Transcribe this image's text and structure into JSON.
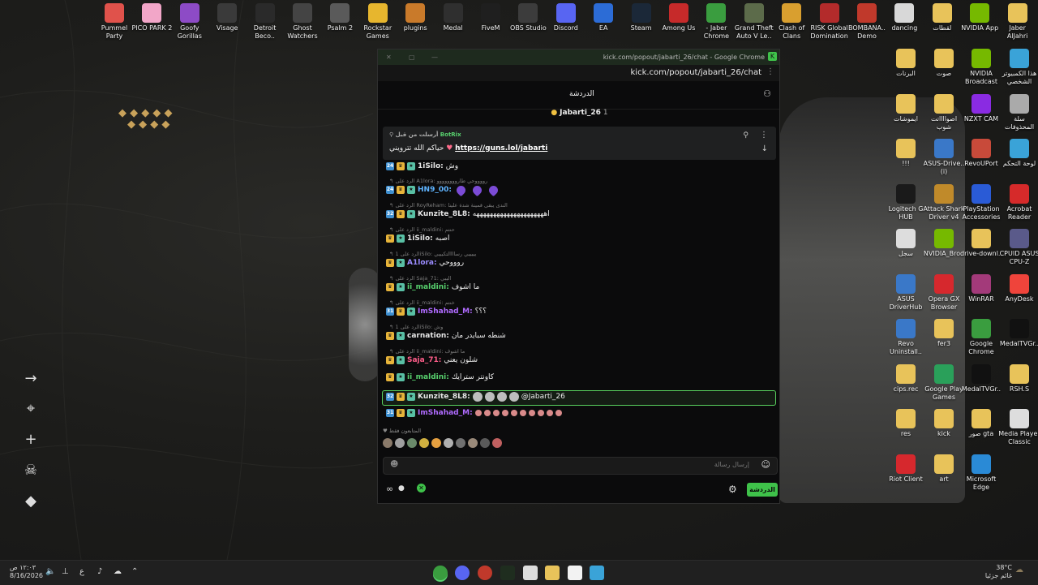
{
  "desktop": {
    "top_icons": [
      {
        "label": "Pummel\nParty",
        "color": "#e0524b"
      },
      {
        "label": "PICO PARK 2",
        "color": "#f2a6c8"
      },
      {
        "label": "Goofy\nGorillas",
        "color": "#8d4bc6"
      },
      {
        "label": "Visage",
        "color": "#3a3a3a"
      },
      {
        "label": "Detroit\nBeco..",
        "color": "#2a2a2a"
      },
      {
        "label": "Ghost\nWatchers",
        "color": "#444"
      },
      {
        "label": "Psalm 2",
        "color": "#5a5a5a"
      },
      {
        "label": "Rockstar\nGames",
        "color": "#e7b62e"
      },
      {
        "label": "plugins",
        "color": "#c97a2a"
      },
      {
        "label": "Medal",
        "color": "#2f2f2f"
      },
      {
        "label": "FiveM",
        "color": "#1f1f1f"
      },
      {
        "label": "OBS Studio",
        "color": "#3c3c3c"
      },
      {
        "label": "Discord",
        "color": "#5865f2"
      },
      {
        "label": "EA",
        "color": "#2c6cd6"
      },
      {
        "label": "Steam",
        "color": "#1b2838"
      },
      {
        "label": "Among Us",
        "color": "#c62a2a"
      },
      {
        "label": "- Jaber\nChrome",
        "color": "#3a9d3f"
      },
      {
        "label": "Grand Theft\nAuto V Le..",
        "color": "#5c6b4a"
      },
      {
        "label": "Clash of\nClans",
        "color": "#d99f2f"
      },
      {
        "label": "RISK Global\nDomination",
        "color": "#b32b2b"
      },
      {
        "label": "BOMBANA..\nDemo",
        "color": "#c0392b"
      },
      {
        "label": "dancing",
        "color": "#d8d8d8"
      },
      {
        "label": "لقطات",
        "color": "#e8c35a"
      },
      {
        "label": "NVIDIA App",
        "color": "#76b900"
      },
      {
        "label": "Jaber\nAlJahri",
        "color": "#e8c35a"
      }
    ],
    "right_icons": [
      {
        "label": "البرنات",
        "color": "#e8c35a"
      },
      {
        "label": "صوت",
        "color": "#e8c35a"
      },
      {
        "label": "NVIDIA\nBroadcast",
        "color": "#76b900"
      },
      {
        "label": "هذا الكمبيوتر\nالشخصي",
        "color": "#3aa3d8"
      },
      {
        "label": "ايموشات",
        "color": "#e8c35a"
      },
      {
        "label": "اصوااااتت\nشوب",
        "color": "#e8c35a"
      },
      {
        "label": "NZXT CAM",
        "color": "#8a2be2"
      },
      {
        "label": "سلة\nالمحذوفات",
        "color": "#aaaaaa"
      },
      {
        "label": "!!!",
        "color": "#e8c35a"
      },
      {
        "label": "ASUS-Drive..\n(i)",
        "color": "#3a78c8"
      },
      {
        "label": "RevoUPort",
        "color": "#c84a3a"
      },
      {
        "label": "لوحة التحكم",
        "color": "#3aa3d8"
      },
      {
        "label": "Logitech G\nHUB",
        "color": "#1a1a1a"
      },
      {
        "label": "Attack Shark\nDriver v4",
        "color": "#c08a2a"
      },
      {
        "label": "PlayStation\nAccessories",
        "color": "#2a5bd6"
      },
      {
        "label": "Acrobat\nReader",
        "color": "#d62a2a"
      },
      {
        "label": "سجل",
        "color": "#dddddd"
      },
      {
        "label": "NVIDIA_Bro..",
        "color": "#76b900"
      },
      {
        "label": "drive-downl..",
        "color": "#e8c35a"
      },
      {
        "label": "CPUID ASUS\nCPU-Z",
        "color": "#5a5a8a"
      },
      {
        "label": "ASUS\nDriverHub",
        "color": "#3a78c8"
      },
      {
        "label": "Opera GX\nBrowser",
        "color": "#d6282d"
      },
      {
        "label": "WinRAR",
        "color": "#a33a7a"
      },
      {
        "label": "AnyDesk",
        "color": "#ef443b"
      },
      {
        "label": "Revo\nUninstall..",
        "color": "#3a78c8"
      },
      {
        "label": "fer3",
        "color": "#e8c35a"
      },
      {
        "label": "Google\nChrome",
        "color": "#3a9d3f"
      },
      {
        "label": "MedalTVGr..",
        "color": "#111111"
      },
      {
        "label": "cips.rec",
        "color": "#e8c35a"
      },
      {
        "label": "Google Play\nGames",
        "color": "#2aa05a"
      },
      {
        "label": "MedalTVGr..",
        "color": "#111111"
      },
      {
        "label": "RSH.S",
        "color": "#e8c35a"
      },
      {
        "label": "res",
        "color": "#e8c35a"
      },
      {
        "label": "kick",
        "color": "#e8c35a"
      },
      {
        "label": "صور gta",
        "color": "#e8c35a"
      },
      {
        "label": "Media Player\nClassic",
        "color": "#dddddd"
      },
      {
        "label": "Riot Client",
        "color": "#d6282d"
      },
      {
        "label": "art",
        "color": "#e8c35a"
      },
      {
        "label": "Microsoft\nEdge",
        "color": "#2a8ad6"
      }
    ]
  },
  "browser": {
    "title": "kick.com/popout/jabarti_26/chat - Google Chrome",
    "url": "kick.com/popout/jabarti_26/chat"
  },
  "chat": {
    "header_title": "الدردشة",
    "channel_name": "Jabarti_26",
    "channel_prefix": "1",
    "pinned": {
      "by": "BotRix",
      "pinned_by_label": "أرسلت من قبل",
      "text_prefix": "حياكم الله تترويني",
      "link": "https://guns.lol/jabarti"
    },
    "messages": [
      {
        "reply": "",
        "user": "1iSilo",
        "text": "وش",
        "color": "#e6e6e6",
        "badge": "24"
      },
      {
        "reply": "الرد على A1lora: رووووحي طاروووووووو",
        "user": "HN9_00",
        "text": "",
        "color": "#5fb4ff",
        "badge": "24",
        "purple": true
      },
      {
        "reply": "الرد على RoyReham: الندى يبقى قمينة شدة علينا",
        "user": "Kunzite_8L8",
        "text": "اهههههههههههههههههههههه",
        "color": "#e6e6e6",
        "badge": "32"
      },
      {
        "reply": "الرد على ii_maldini: حنتم",
        "user": "1iSilo",
        "text": "اصبه",
        "color": "#e6e6e6",
        "badge": ""
      },
      {
        "reply": "الرد على 1iSilo: يييييي رساااالتكيييي",
        "user": "A1lora",
        "text": "روووحي",
        "color": "#9b8cff",
        "badge": ""
      },
      {
        "reply": "الرد على Saja_71: اليبي",
        "user": "ii_maldini",
        "text": "ما اشوف",
        "color": "#58d16e",
        "badge": ""
      },
      {
        "reply": "الرد على ii_maldini: خنتم",
        "user": "ImShahad_M",
        "text": "؟؟؟",
        "color": "#b06bff",
        "badge": "31"
      },
      {
        "reply": "الرد على 1iSilo: وش",
        "user": "carnation",
        "text": "شنطه سبايدر مان",
        "color": "#e6e6e6",
        "badge": ""
      },
      {
        "reply": "الرد على ii_maldini: ما اشوف",
        "user": "Saja_71",
        "text": "شلون يعني",
        "color": "#ff5e8a",
        "badge": ""
      },
      {
        "reply": "",
        "user": "ii_maldini",
        "text": "كاونتر سترايك",
        "color": "#58d16e",
        "badge": ""
      },
      {
        "reply": "",
        "user": "Kunzite_8L8",
        "text": "@Jabarti_26",
        "color": "#e6e6e6",
        "badge": "32",
        "highlight": true
      },
      {
        "reply": "",
        "user": "ImShahad_M",
        "text": "",
        "color": "#b06bff",
        "badge": "31"
      }
    ],
    "supporters_label": "المتابعون فقط",
    "input_placeholder": "إرسال رسالة",
    "send_button": "الدردشة"
  },
  "taskbar": {
    "time": "١٢:٠٣ ص",
    "date": "8/16/2026",
    "lang": "ع",
    "weather_temp": "38°C",
    "weather_text": "غائم جزئيا"
  }
}
